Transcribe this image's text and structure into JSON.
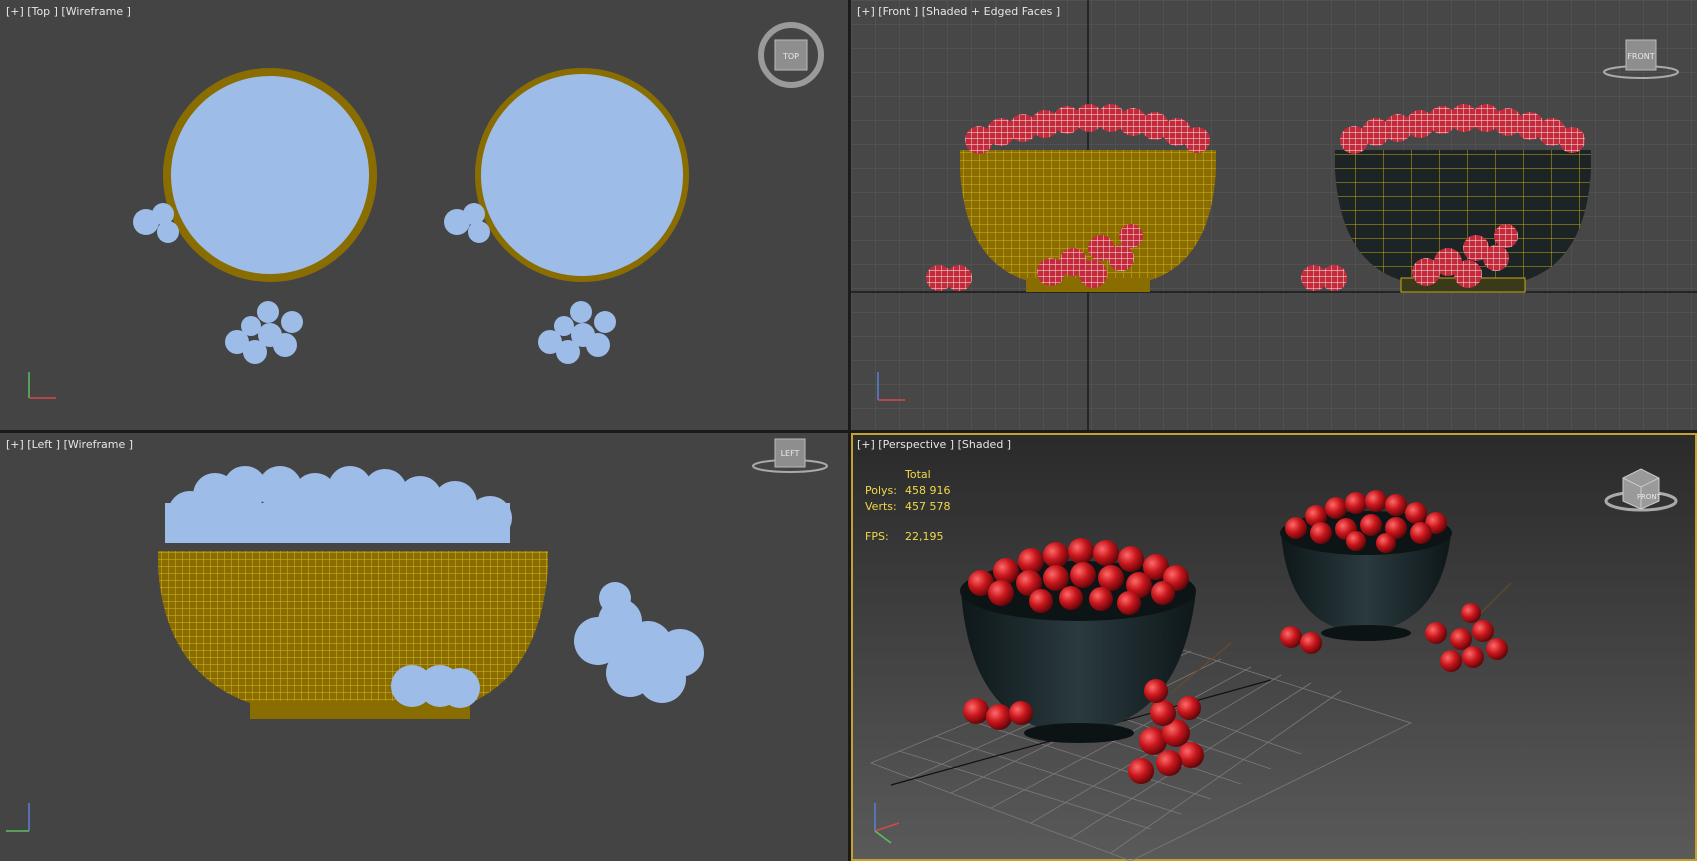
{
  "viewports": {
    "top": {
      "label": "[+] [Top ] [Wireframe ]",
      "nav": "TOP"
    },
    "front": {
      "label": "[+] [Front ] [Shaded + Edged Faces ]",
      "nav": "FRONT"
    },
    "left": {
      "label": "[+] [Left ] [Wireframe ]",
      "nav": "LEFT"
    },
    "persp": {
      "label": "[+] [Perspective ] [Shaded ]",
      "nav": "FRONT"
    }
  },
  "stats": {
    "header": "Total",
    "polys_label": "Polys:",
    "polys_value": "458 916",
    "verts_label": "Verts:",
    "verts_value": "457 578",
    "fps_label": "FPS:",
    "fps_value": "22,195"
  },
  "colors": {
    "viewport_bg": "#444444",
    "active_border": "#c6a22c",
    "wire_bowl": "#8a6d00",
    "wire_fruit": "#9dbde8",
    "cherry_red": "#c8161c",
    "bowl_dark": "#1e2a2d",
    "stats_text": "#f0d94a"
  },
  "icons": [
    "viewcube-icon",
    "axis-tripod-icon"
  ]
}
